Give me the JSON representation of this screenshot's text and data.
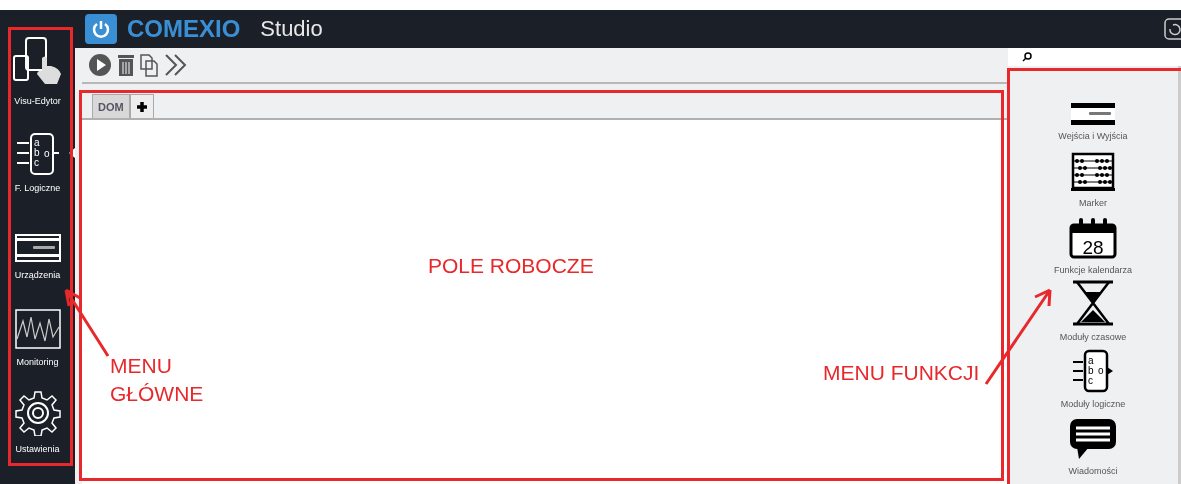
{
  "header": {
    "logo_text": "COMEXIO",
    "app_name": "Studio"
  },
  "sidebar": {
    "items": [
      {
        "kind": "visu",
        "label": "Visu-Edytor",
        "selected": false
      },
      {
        "kind": "logic",
        "label": "F. Logiczne",
        "selected": true,
        "pins": [
          "a",
          "b",
          "c"
        ],
        "output": "o"
      },
      {
        "kind": "device",
        "label": "Urządzenia",
        "selected": false
      },
      {
        "kind": "monitor",
        "label": "Monitoring",
        "selected": false
      },
      {
        "kind": "settings",
        "label": "Ustawienia",
        "selected": false
      }
    ]
  },
  "tabs": [
    {
      "label": "DOM",
      "selected": true
    }
  ],
  "functions": [
    {
      "kind": "io",
      "label": "Wejścia i Wyjścia"
    },
    {
      "kind": "abacus",
      "label": "Marker"
    },
    {
      "kind": "calendar",
      "label": "Funkcje kalendarza",
      "day": "28"
    },
    {
      "kind": "hourglass",
      "label": "Moduły czasowe"
    },
    {
      "kind": "logic",
      "label": "Moduły logiczne",
      "pins": [
        "a",
        "b",
        "c"
      ],
      "output": "o"
    },
    {
      "kind": "message",
      "label": "Wiadomości"
    }
  ],
  "annotations": [
    {
      "label": "POLE ROBOCZE"
    },
    {
      "label": "MENU GŁÓWNE"
    },
    {
      "label": "MENU FUNKCJI"
    }
  ]
}
